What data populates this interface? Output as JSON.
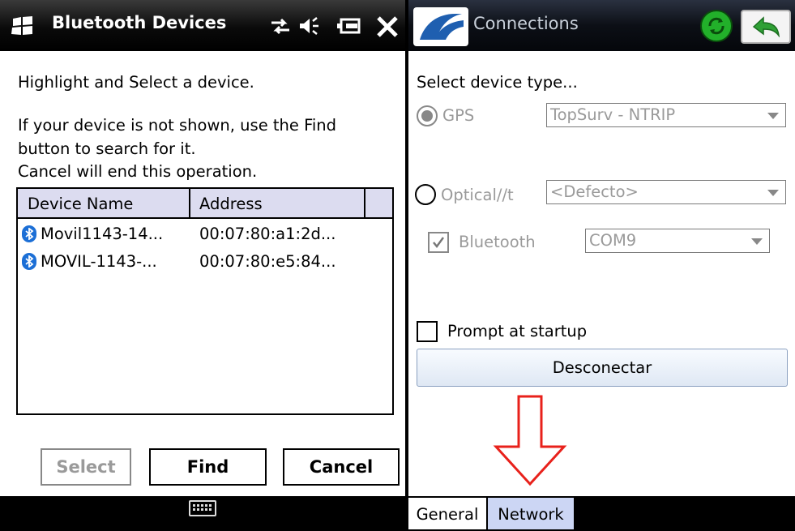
{
  "left": {
    "title": "Bluetooth Devices",
    "status_icons": [
      "network-arrows-icon",
      "speaker-icon",
      "battery-icon",
      "close-icon"
    ],
    "instructions": {
      "line1": "Highlight and Select a device.",
      "line2": "If your device is not shown, use the Find",
      "line3": "button to search for it.",
      "line4": "Cancel will end this operation."
    },
    "table": {
      "headers": [
        "Device Name",
        "Address"
      ],
      "rows": [
        {
          "name": "Movil1143-14...",
          "address": "00:07:80:a1:2d..."
        },
        {
          "name": "MOVIL-1143-...",
          "address": "00:07:80:e5:84..."
        }
      ]
    },
    "buttons": {
      "select": "Select",
      "find": "Find",
      "cancel": "Cancel"
    }
  },
  "right": {
    "title": "Connections",
    "select_device_type": "Select device type...",
    "gps": {
      "label": "GPS",
      "combo": "TopSurv - NTRIP"
    },
    "optical": {
      "label": "Optical//t",
      "combo": "<Defecto>"
    },
    "bluetooth": {
      "label": "Bluetooth",
      "combo": "COM9"
    },
    "prompt_label": "Prompt at startup",
    "disconnect_button": "Desconectar",
    "tabs": {
      "general": "General",
      "network": "Network"
    }
  },
  "colors": {
    "accent_arrow": "#e8211b",
    "tab_selected": "#ccd6f4",
    "bluetooth_icon": "#1c6fd6",
    "sync_icon": "#22b02a"
  }
}
